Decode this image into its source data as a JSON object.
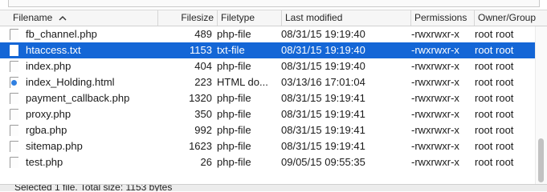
{
  "columns": {
    "filename": "Filename",
    "filesize": "Filesize",
    "filetype": "Filetype",
    "last_modified": "Last modified",
    "permissions": "Permissions",
    "owner_group": "Owner/Group"
  },
  "sort": {
    "column": "filename",
    "direction": "ascending"
  },
  "files": [
    {
      "name": "fb_channel.php",
      "size": "489",
      "type": "php-file",
      "modified": "08/31/15 19:19:40",
      "permissions": "-rwxrwxr-x",
      "owner": "root root",
      "icon": "file-icon",
      "selected": false
    },
    {
      "name": "htaccess.txt",
      "size": "1153",
      "type": "txt-file",
      "modified": "08/31/15 19:19:40",
      "permissions": "-rwxrwxr-x",
      "owner": "root root",
      "icon": "file-icon",
      "selected": true
    },
    {
      "name": "index.php",
      "size": "404",
      "type": "php-file",
      "modified": "08/31/15 19:19:40",
      "permissions": "-rwxrwxr-x",
      "owner": "root root",
      "icon": "file-icon",
      "selected": false
    },
    {
      "name": "index_Holding.html",
      "size": "223",
      "type": "HTML do...",
      "modified": "03/13/16 17:01:04",
      "permissions": "-rwxrwxr-x",
      "owner": "root root",
      "icon": "html-file-icon",
      "selected": false
    },
    {
      "name": "payment_callback.php",
      "size": "1320",
      "type": "php-file",
      "modified": "08/31/15 19:19:41",
      "permissions": "-rwxrwxr-x",
      "owner": "root root",
      "icon": "file-icon",
      "selected": false
    },
    {
      "name": "proxy.php",
      "size": "350",
      "type": "php-file",
      "modified": "08/31/15 19:19:41",
      "permissions": "-rwxrwxr-x",
      "owner": "root root",
      "icon": "file-icon",
      "selected": false
    },
    {
      "name": "rgba.php",
      "size": "992",
      "type": "php-file",
      "modified": "08/31/15 19:19:41",
      "permissions": "-rwxrwxr-x",
      "owner": "root root",
      "icon": "file-icon",
      "selected": false
    },
    {
      "name": "sitemap.php",
      "size": "1623",
      "type": "php-file",
      "modified": "08/31/15 19:19:41",
      "permissions": "-rwxrwxr-x",
      "owner": "root root",
      "icon": "file-icon",
      "selected": false
    },
    {
      "name": "test.php",
      "size": "26",
      "type": "php-file",
      "modified": "09/05/15 09:55:35",
      "permissions": "-rwxrwxr-x",
      "owner": "root root",
      "icon": "file-icon",
      "selected": false
    }
  ],
  "status": {
    "text": "Selected 1 file. Total size: 1153 bytes"
  },
  "colors": {
    "selection": "#1466d6",
    "header_bg": "#f6f6f6"
  }
}
